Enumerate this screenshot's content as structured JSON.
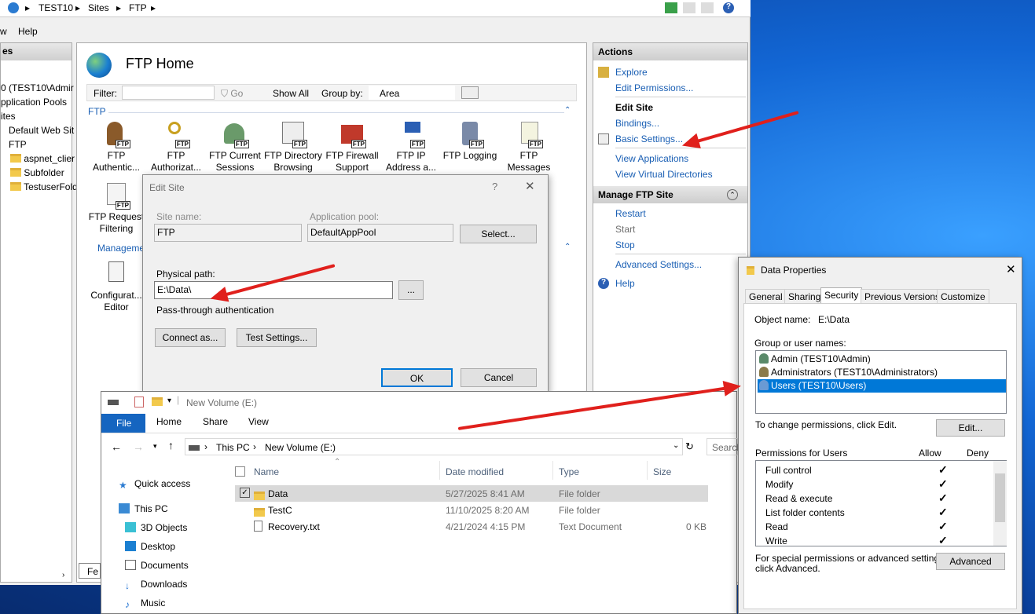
{
  "breadcrumb": [
    "TEST10",
    "Sites",
    "FTP"
  ],
  "menu": {
    "view_partial": "w",
    "help": "Help"
  },
  "connections": {
    "header_partial": "es",
    "items": [
      "0 (TEST10\\Admir",
      "pplication Pools",
      "ites",
      "Default Web Sit",
      "FTP",
      "aspnet_clier",
      "Subfolder",
      "TestuserFold"
    ]
  },
  "center": {
    "title": "FTP Home",
    "filter_label": "Filter:",
    "go_label": "Go",
    "show_all": "Show All",
    "group_by_label": "Group by:",
    "group_by_value": "Area",
    "section_ftp": "FTP",
    "section_mgmt": "Manageme",
    "features": [
      {
        "l1": "FTP",
        "l2": "Authentic..."
      },
      {
        "l1": "FTP",
        "l2": "Authorizat..."
      },
      {
        "l1": "FTP Current",
        "l2": "Sessions"
      },
      {
        "l1": "FTP Directory",
        "l2": "Browsing"
      },
      {
        "l1": "FTP Firewall",
        "l2": "Support"
      },
      {
        "l1": "FTP IP",
        "l2": "Address a..."
      },
      {
        "l1": "FTP Logging",
        "l2": ""
      },
      {
        "l1": "FTP",
        "l2": "Messages"
      }
    ],
    "feature_request": {
      "l1": "FTP Request",
      "l2": "Filtering"
    },
    "feature_config": {
      "l1": "Configurat...",
      "l2": "Editor"
    },
    "tag": "FTP",
    "bottom_tab": "Fe"
  },
  "actions": {
    "header": "Actions",
    "explore": "Explore",
    "edit_permissions": "Edit Permissions...",
    "edit_site": "Edit Site",
    "bindings": "Bindings...",
    "basic_settings": "Basic Settings...",
    "view_applications": "View Applications",
    "view_virtual_dirs": "View Virtual Directories",
    "manage_header": "Manage FTP Site",
    "restart": "Restart",
    "start": "Start",
    "stop": "Stop",
    "advanced_settings": "Advanced Settings...",
    "help": "Help"
  },
  "edit_site": {
    "title": "Edit Site",
    "help": "?",
    "site_name_label": "Site name:",
    "site_name": "FTP",
    "app_pool_label": "Application pool:",
    "app_pool": "DefaultAppPool",
    "select": "Select...",
    "physical_path_label": "Physical path:",
    "physical_path": "E:\\Data\\",
    "browse": "...",
    "auth": "Pass-through authentication",
    "connect_as": "Connect as...",
    "test_settings": "Test Settings...",
    "ok": "OK",
    "cancel": "Cancel"
  },
  "explorer": {
    "title": "New Volume (E:)",
    "tabs": [
      "File",
      "Home",
      "Share",
      "View"
    ],
    "path": [
      "This PC",
      "New Volume (E:)"
    ],
    "search": "Search",
    "columns": [
      "Name",
      "Date modified",
      "Type",
      "Size"
    ],
    "files": [
      {
        "name": "Data",
        "date": "5/27/2025 8:41 AM",
        "type": "File folder",
        "size": ""
      },
      {
        "name": "TestC",
        "date": "11/10/2025 8:20 AM",
        "type": "File folder",
        "size": ""
      },
      {
        "name": "Recovery.txt",
        "date": "4/21/2024 4:15 PM",
        "type": "Text Document",
        "size": "0 KB"
      }
    ],
    "nav": [
      "Quick access",
      "This PC",
      "3D Objects",
      "Desktop",
      "Documents",
      "Downloads",
      "Music"
    ]
  },
  "props": {
    "title": "Data Properties",
    "tabs": [
      "General",
      "Sharing",
      "Security",
      "Previous Versions",
      "Customize"
    ],
    "object_label": "Object name:",
    "object_value": "E:\\Data",
    "group_label": "Group or user names:",
    "users": [
      "Admin (TEST10\\Admin)",
      "Administrators (TEST10\\Administrators)",
      "Users (TEST10\\Users)"
    ],
    "change_text": "To change permissions, click Edit.",
    "edit": "Edit...",
    "perms_label": "Permissions for Users",
    "allow": "Allow",
    "deny": "Deny",
    "perms": [
      "Full control",
      "Modify",
      "Read & execute",
      "List folder contents",
      "Read",
      "Write"
    ],
    "special_1": "For special permissions or advanced settings,",
    "special_2": "click Advanced.",
    "advanced": "Advanced"
  }
}
